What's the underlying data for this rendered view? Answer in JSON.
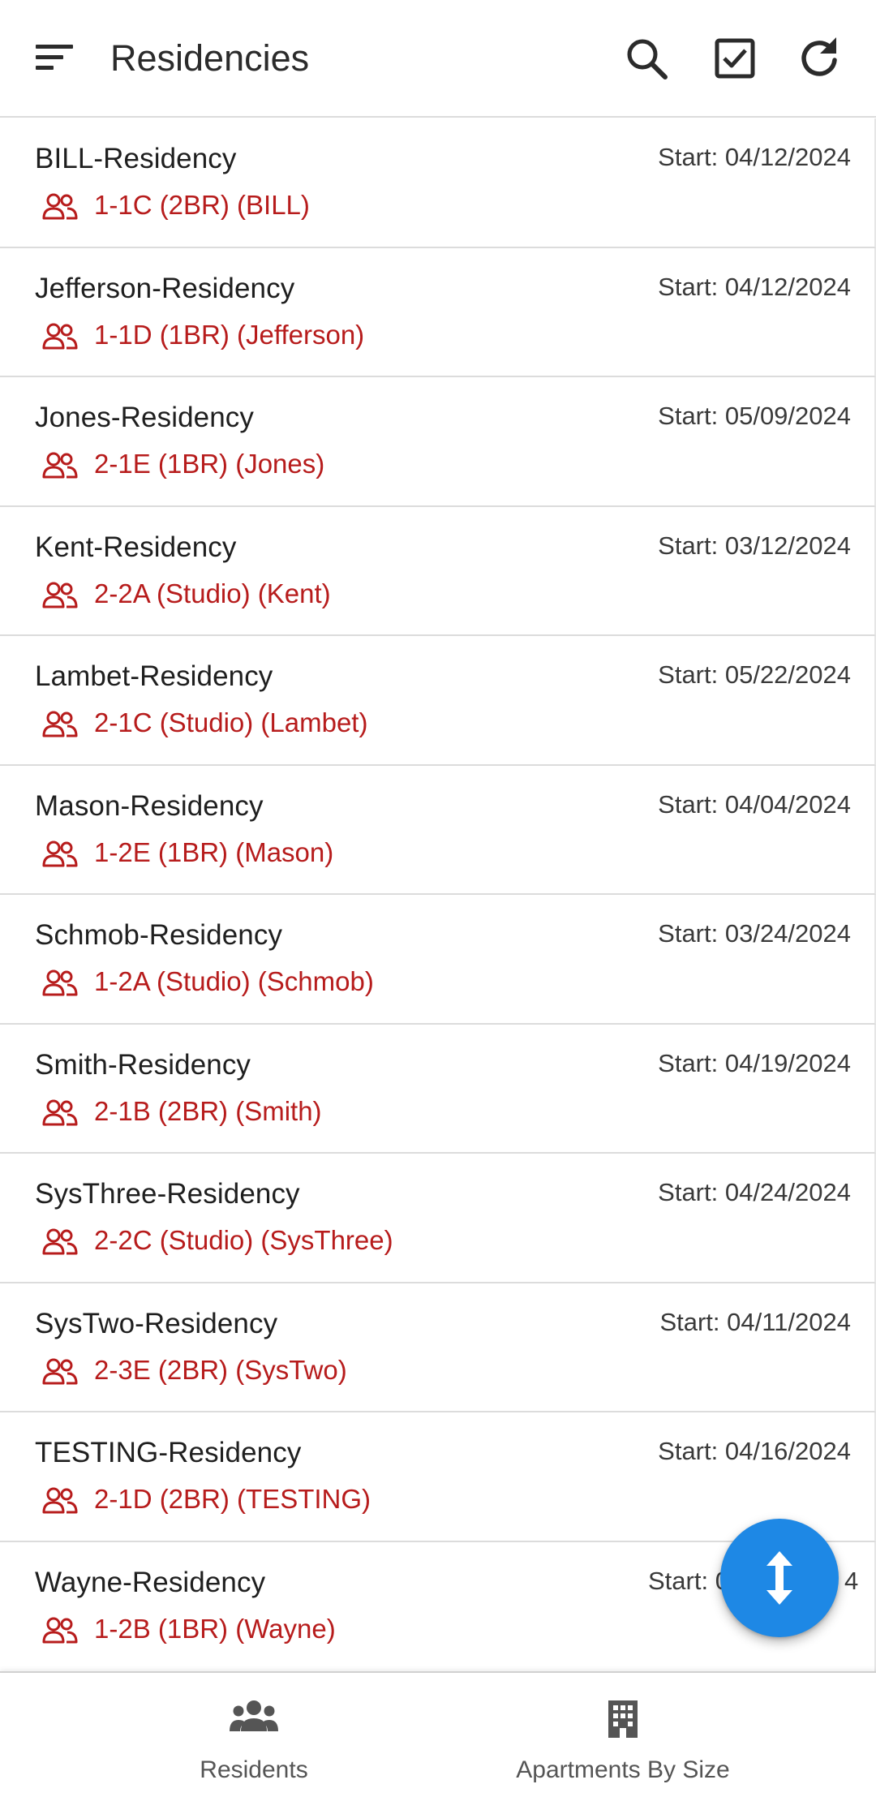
{
  "app_bar": {
    "title": "Residencies",
    "menu_icon": "sort-menu-icon",
    "actions": [
      "search-icon",
      "checkbox-icon",
      "refresh-icon"
    ]
  },
  "colors": {
    "accent": "#b71c1c",
    "fab": "#1e88e5",
    "divider": "#dcdcdc"
  },
  "residencies": [
    {
      "name": "BILL-Residency",
      "start": "Start: 04/12/2024",
      "unit": "1-1C (2BR) (BILL)"
    },
    {
      "name": "Jefferson-Residency",
      "start": "Start: 04/12/2024",
      "unit": "1-1D (1BR) (Jefferson)"
    },
    {
      "name": "Jones-Residency",
      "start": "Start: 05/09/2024",
      "unit": "2-1E (1BR) (Jones)"
    },
    {
      "name": "Kent-Residency",
      "start": "Start: 03/12/2024",
      "unit": "2-2A (Studio) (Kent)"
    },
    {
      "name": "Lambet-Residency",
      "start": "Start: 05/22/2024",
      "unit": "2-1C (Studio) (Lambet)"
    },
    {
      "name": "Mason-Residency",
      "start": "Start: 04/04/2024",
      "unit": "1-2E (1BR) (Mason)"
    },
    {
      "name": "Schmob-Residency",
      "start": "Start: 03/24/2024",
      "unit": "1-2A (Studio) (Schmob)"
    },
    {
      "name": "Smith-Residency",
      "start": "Start: 04/19/2024",
      "unit": "2-1B (2BR) (Smith)"
    },
    {
      "name": "SysThree-Residency",
      "start": "Start: 04/24/2024",
      "unit": "2-2C (Studio) (SysThree)"
    },
    {
      "name": "SysTwo-Residency",
      "start": "Start: 04/11/2024",
      "unit": "2-3E (2BR) (SysTwo)"
    },
    {
      "name": "TESTING-Residency",
      "start": "Start: 04/16/2024",
      "unit": "2-1D (2BR) (TESTING)"
    },
    {
      "name": "Wayne-Residency",
      "start": "Start: 0",
      "start_tail": "4",
      "unit": "1-2B (1BR) (Wayne)"
    }
  ],
  "fab": {
    "icon": "vertical-resize-icon"
  },
  "bottom_nav": {
    "residents_label": "Residents",
    "residents_icon": "people-icon",
    "apartments_label": "Apartments By Size",
    "apartments_icon": "building-icon"
  }
}
